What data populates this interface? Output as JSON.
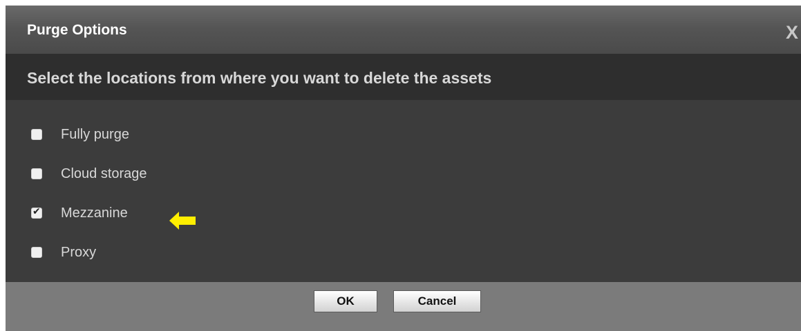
{
  "dialog": {
    "title": "Purge Options",
    "close_label": "X",
    "instruction": "Select the locations from where you want to delete the assets"
  },
  "options": [
    {
      "label": "Fully purge",
      "checked": false
    },
    {
      "label": "Cloud storage",
      "checked": false
    },
    {
      "label": "Mezzanine",
      "checked": true
    },
    {
      "label": "Proxy",
      "checked": false
    }
  ],
  "annotation": {
    "icon": "arrow-left-icon",
    "color": "#ffee00"
  },
  "buttons": {
    "ok_label": "OK",
    "cancel_label": "Cancel"
  }
}
